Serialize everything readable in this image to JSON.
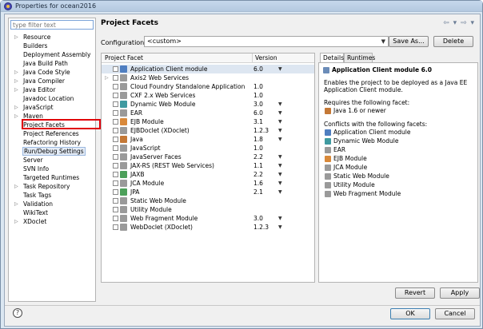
{
  "window": {
    "title": "Properties for ocean2016"
  },
  "filter": {
    "placeholder": "type filter text"
  },
  "tree": {
    "items": [
      {
        "label": "Resource",
        "expandable": true
      },
      {
        "label": "Builders",
        "expandable": false
      },
      {
        "label": "Deployment Assembly",
        "expandable": false
      },
      {
        "label": "Java Build Path",
        "expandable": false
      },
      {
        "label": "Java Code Style",
        "expandable": true
      },
      {
        "label": "Java Compiler",
        "expandable": true
      },
      {
        "label": "Java Editor",
        "expandable": true
      },
      {
        "label": "Javadoc Location",
        "expandable": false
      },
      {
        "label": "JavaScript",
        "expandable": true
      },
      {
        "label": "Maven",
        "expandable": true
      },
      {
        "label": "Project Facets",
        "expandable": false
      },
      {
        "label": "Project References",
        "expandable": false
      },
      {
        "label": "Refactoring History",
        "expandable": false
      },
      {
        "label": "Run/Debug Settings",
        "expandable": false
      },
      {
        "label": "Server",
        "expandable": false
      },
      {
        "label": "SVN Info",
        "expandable": false
      },
      {
        "label": "Targeted Runtimes",
        "expandable": false
      },
      {
        "label": "Task Repository",
        "expandable": true
      },
      {
        "label": "Task Tags",
        "expandable": false
      },
      {
        "label": "Validation",
        "expandable": true
      },
      {
        "label": "WikiText",
        "expandable": false
      },
      {
        "label": "XDoclet",
        "expandable": true
      }
    ]
  },
  "page": {
    "title": "Project Facets",
    "nav_back": "⇦ ▾",
    "nav_forward": "⇨ ▾"
  },
  "configuration": {
    "label": "Configuration:",
    "value": "<custom>",
    "save_as": "Save As...",
    "delete": "Delete"
  },
  "facets": {
    "col_facet": "Project Facet",
    "col_version": "Version",
    "rows": [
      {
        "name": "Application Client module",
        "version": "6.0",
        "dropdown": true,
        "icon": "c-blue",
        "expander": false,
        "selected": true
      },
      {
        "name": "Axis2 Web Services",
        "version": "",
        "dropdown": false,
        "icon": "c-gray",
        "expander": true
      },
      {
        "name": "Cloud Foundry Standalone Application",
        "version": "1.0",
        "dropdown": false,
        "icon": "c-gray",
        "expander": false
      },
      {
        "name": "CXF 2.x Web Services",
        "version": "1.0",
        "dropdown": false,
        "icon": "c-gray",
        "expander": false
      },
      {
        "name": "Dynamic Web Module",
        "version": "3.0",
        "dropdown": true,
        "icon": "c-teal",
        "expander": false
      },
      {
        "name": "EAR",
        "version": "6.0",
        "dropdown": true,
        "icon": "c-gray",
        "expander": false
      },
      {
        "name": "EJB Module",
        "version": "3.1",
        "dropdown": true,
        "icon": "c-orange",
        "expander": false
      },
      {
        "name": "EJBDoclet (XDoclet)",
        "version": "1.2.3",
        "dropdown": true,
        "icon": "c-gray",
        "expander": false
      },
      {
        "name": "Java",
        "version": "1.8",
        "dropdown": true,
        "icon": "c-java",
        "expander": false
      },
      {
        "name": "JavaScript",
        "version": "1.0",
        "dropdown": false,
        "icon": "c-gray",
        "expander": false
      },
      {
        "name": "JavaServer Faces",
        "version": "2.2",
        "dropdown": true,
        "icon": "c-gray",
        "expander": false
      },
      {
        "name": "JAX-RS (REST Web Services)",
        "version": "1.1",
        "dropdown": true,
        "icon": "c-gray",
        "expander": false
      },
      {
        "name": "JAXB",
        "version": "2.2",
        "dropdown": true,
        "icon": "c-green",
        "expander": false
      },
      {
        "name": "JCA Module",
        "version": "1.6",
        "dropdown": true,
        "icon": "c-gray",
        "expander": false
      },
      {
        "name": "JPA",
        "version": "2.1",
        "dropdown": true,
        "icon": "c-green",
        "expander": false
      },
      {
        "name": "Static Web Module",
        "version": "",
        "dropdown": false,
        "icon": "c-gray",
        "expander": false
      },
      {
        "name": "Utility Module",
        "version": "",
        "dropdown": false,
        "icon": "c-gray",
        "expander": false
      },
      {
        "name": "Web Fragment Module",
        "version": "3.0",
        "dropdown": true,
        "icon": "c-gray",
        "expander": false
      },
      {
        "name": "WebDoclet (XDoclet)",
        "version": "1.2.3",
        "dropdown": true,
        "icon": "c-gray",
        "expander": false
      }
    ]
  },
  "details": {
    "tab_details": "Details",
    "tab_runtimes": "Runtimes",
    "title": "Application Client module 6.0",
    "description": "Enables the project to be deployed as a Java EE Application Client module.",
    "requires_label": "Requires the following facet:",
    "requires": [
      {
        "name": "Java 1.6 or newer",
        "icon": "c-java"
      }
    ],
    "conflicts_label": "Conflicts with the following facets:",
    "conflicts": [
      {
        "name": "Application Client module",
        "icon": "c-blue"
      },
      {
        "name": "Dynamic Web Module",
        "icon": "c-teal"
      },
      {
        "name": "EAR",
        "icon": "c-gray"
      },
      {
        "name": "EJB Module",
        "icon": "c-orange"
      },
      {
        "name": "JCA Module",
        "icon": "c-gray"
      },
      {
        "name": "Static Web Module",
        "icon": "c-gray"
      },
      {
        "name": "Utility Module",
        "icon": "c-gray"
      },
      {
        "name": "Web Fragment Module",
        "icon": "c-gray"
      }
    ]
  },
  "buttons": {
    "revert": "Revert",
    "apply": "Apply",
    "ok": "OK",
    "cancel": "Cancel",
    "help": "?"
  }
}
